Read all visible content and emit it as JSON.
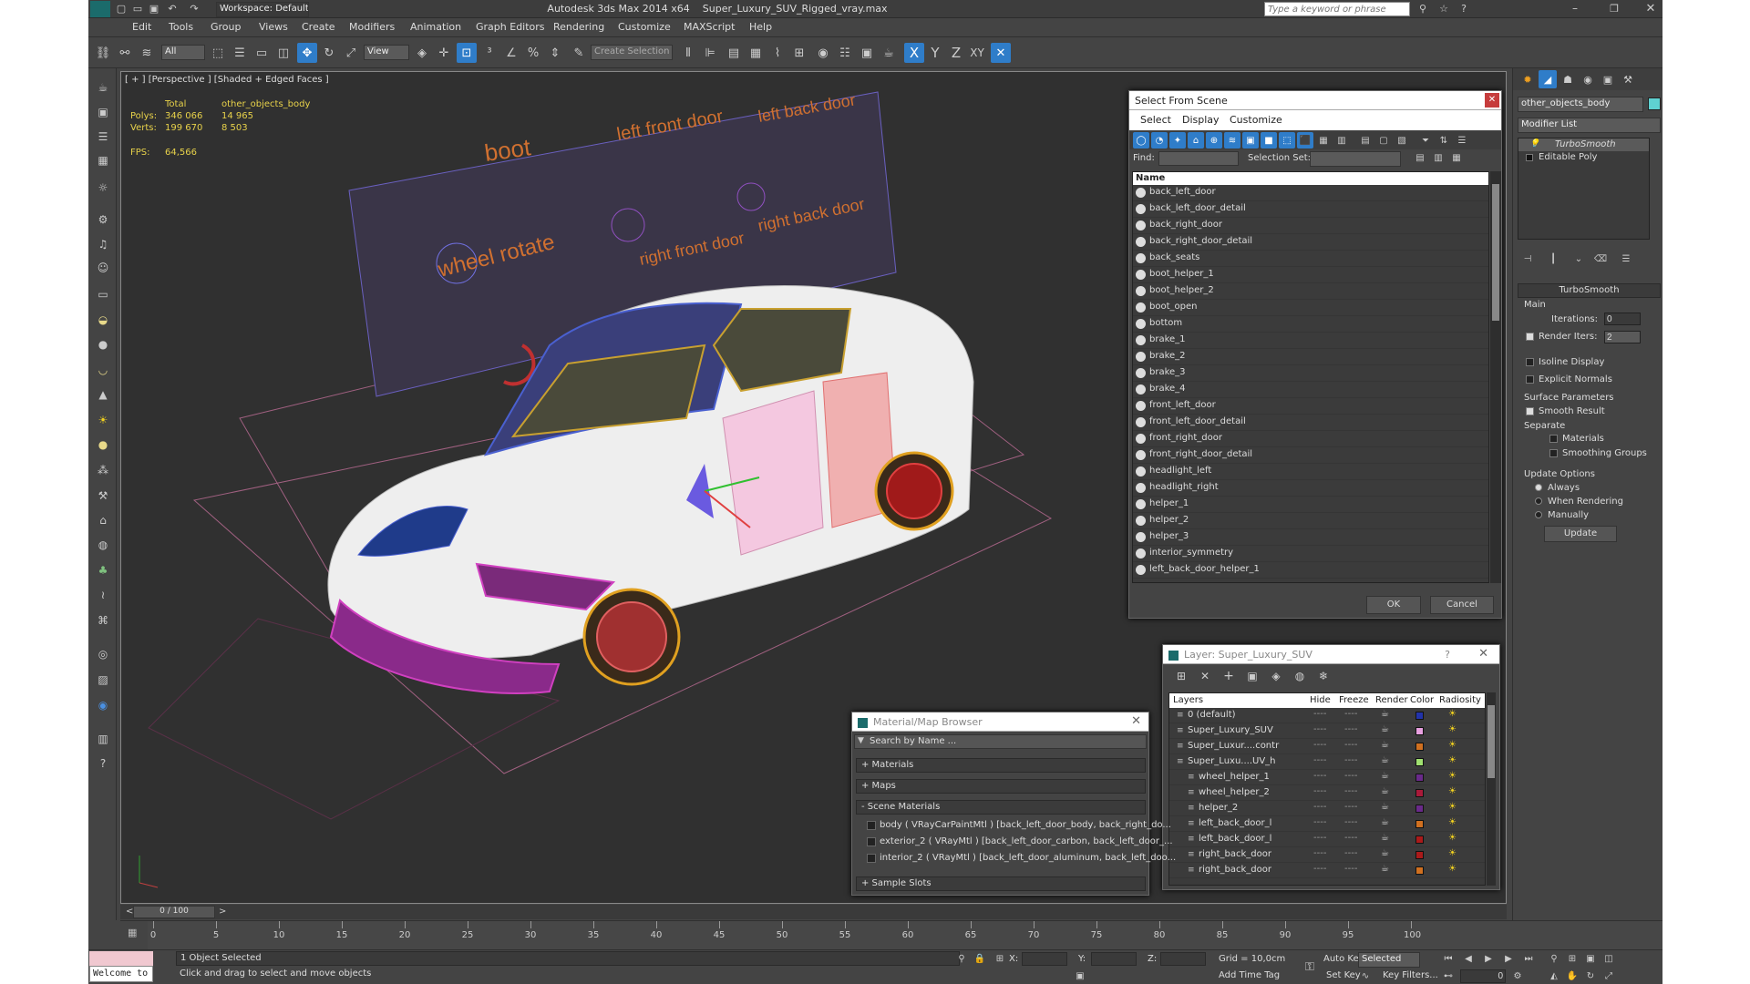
{
  "title": {
    "app": "Autodesk 3ds Max  2014 x64",
    "file": "Super_Luxury_SUV_Rigged_vray.max",
    "workspace": "Workspace: Default",
    "search_placeholder": "Type a keyword or phrase"
  },
  "menu": [
    "Edit",
    "Tools",
    "Group",
    "Views",
    "Create",
    "Modifiers",
    "Animation",
    "Graph Editors",
    "Rendering",
    "Customize",
    "MAXScript",
    "Help"
  ],
  "toolbar": {
    "filter": "All",
    "refcoord": "View",
    "selset": "Create Selection S",
    "axes": [
      "X",
      "Y",
      "Z",
      "XY"
    ]
  },
  "viewport": {
    "label": "[ + ] [Perspective ] [Shaded + Edged Faces ]",
    "stats": {
      "total_label": "Total",
      "object_name": "other_objects_body",
      "polys_label": "Polys:",
      "polys_total": "346 066",
      "polys_obj": "14 965",
      "verts_label": "Verts:",
      "verts_total": "199 670",
      "verts_obj": "8 503",
      "fps_label": "FPS:",
      "fps": "64,566"
    },
    "board_labels": [
      "boot",
      "left front door",
      "left back door",
      "wheel rotate",
      "right front door",
      "right back door"
    ]
  },
  "select_scene": {
    "title": "Select From Scene",
    "menu": [
      "Select",
      "Display",
      "Customize"
    ],
    "find_label": "Find:",
    "selset_label": "Selection Set:",
    "col_name": "Name",
    "items": [
      "back_left_door",
      "back_left_door_detail",
      "back_right_door",
      "back_right_door_detail",
      "back_seats",
      "boot_helper_1",
      "boot_helper_2",
      "boot_open",
      "bottom",
      "brake_1",
      "brake_2",
      "brake_3",
      "brake_4",
      "front_left_door",
      "front_left_door_detail",
      "front_right_door",
      "front_right_door_detail",
      "headlight_left",
      "headlight_right",
      "helper_1",
      "helper_2",
      "helper_3",
      "interior_symmetry",
      "left_back_door_helper_1"
    ],
    "ok": "OK",
    "cancel": "Cancel"
  },
  "layer_dialog": {
    "title": "Layer: Super_Luxury_SUV",
    "help": "?",
    "cols": [
      "Layers",
      "Hide",
      "Freeze",
      "Render",
      "Color",
      "Radiosity"
    ],
    "rows": [
      {
        "name": "0 (default)",
        "color": "#2233aa"
      },
      {
        "name": "Super_Luxury_SUV",
        "color": "#e8a0e0"
      },
      {
        "name": "Super_Luxur....contr",
        "color": "#d07020"
      },
      {
        "name": "Super_Luxu....UV_h",
        "color": "#a0e070"
      },
      {
        "name": "wheel_helper_1",
        "color": "#6a2a8a"
      },
      {
        "name": "wheel_helper_2",
        "color": "#aa1a3a"
      },
      {
        "name": "helper_2",
        "color": "#6a2a8a"
      },
      {
        "name": "left_back_door_l",
        "color": "#d07020"
      },
      {
        "name": "left_back_door_l",
        "color": "#aa1a1a"
      },
      {
        "name": "right_back_door",
        "color": "#aa1a1a"
      },
      {
        "name": "right_back_door",
        "color": "#d07020"
      }
    ],
    "dash": "----"
  },
  "material_browser": {
    "title": "Material/Map Browser",
    "search_placeholder": "Search by Name ...",
    "sections": [
      "+ Materials",
      "+ Maps",
      "- Scene Materials",
      "+ Sample Slots"
    ],
    "scene_materials": [
      "body ( VRayCarPaintMtl ) [back_left_door_body, back_right_do...",
      "exterior_2 ( VRayMtl ) [back_left_door_carbon, back_left_door_...",
      "interior_2 ( VRayMtl ) [back_left_door_aluminum, back_left_doo..."
    ]
  },
  "command_panel": {
    "object_name": "other_objects_body",
    "modifier_list": "Modifier List",
    "stack": [
      "TurboSmooth",
      "Editable Poly"
    ],
    "rollout": "TurboSmooth",
    "main": "Main",
    "iterations_label": "Iterations:",
    "iterations": "0",
    "render_iters_label": "Render Iters:",
    "render_iters": "2",
    "isoline": "Isoline Display",
    "explicit": "Explicit Normals",
    "surface": "Surface Parameters",
    "smooth_result": "Smooth Result",
    "separate": "Separate",
    "materials": "Materials",
    "smoothing_groups": "Smoothing Groups",
    "update_options": "Update Options",
    "always": "Always",
    "when_rendering": "When Rendering",
    "manually": "Manually",
    "update": "Update",
    "accent": "#5fd1d1"
  },
  "timeline": {
    "frame": "0 / 100",
    "ticks": [
      "0",
      "5",
      "10",
      "15",
      "20",
      "25",
      "30",
      "35",
      "40",
      "45",
      "50",
      "55",
      "60",
      "65",
      "70",
      "75",
      "80",
      "85",
      "90",
      "95",
      "100"
    ]
  },
  "status": {
    "listener": "Welcome to M",
    "selected": "1 Object Selected",
    "prompt": "Click and drag to select and move objects",
    "x": "X:",
    "y": "Y:",
    "z": "Z:",
    "grid": "Grid = 10,0cm",
    "time_tag": "Add Time Tag",
    "autokey": "Auto Key",
    "setkey": "Set Key",
    "key_mode": "Selected",
    "key_filters": "Key Filters...",
    "frame": "0"
  }
}
